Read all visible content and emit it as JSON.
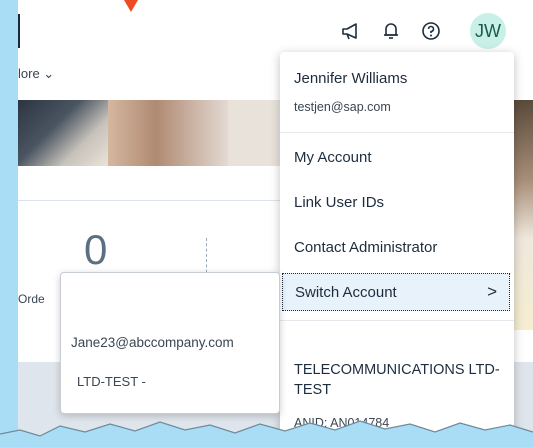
{
  "header": {
    "announcements_icon": "megaphone-icon",
    "notifications_icon": "bell-icon",
    "help_icon": "help-circle-icon",
    "avatar_initials": "JW"
  },
  "background": {
    "more_label": "lore ⌄",
    "tile_value": "0",
    "tile_label": "Orde"
  },
  "user_menu": {
    "name": "Jennifer Williams",
    "email": "testjen@sap.com",
    "items": [
      "My Account",
      "Link User IDs",
      "Contact Administrator"
    ],
    "switch_account": "Switch Account",
    "org_name": "TELECOMMUNICATIONS LTD-TEST",
    "anid": "ANID: AN014784"
  },
  "account_popover": {
    "email": "Jane23@abccompany.com",
    "org": "LTD-TEST -"
  },
  "colors": {
    "frame_bg": "#a9dcf5",
    "avatar_bg": "#c8f0e6",
    "highlight_bg": "#e8f2fb",
    "pointer": "#f04a22"
  }
}
